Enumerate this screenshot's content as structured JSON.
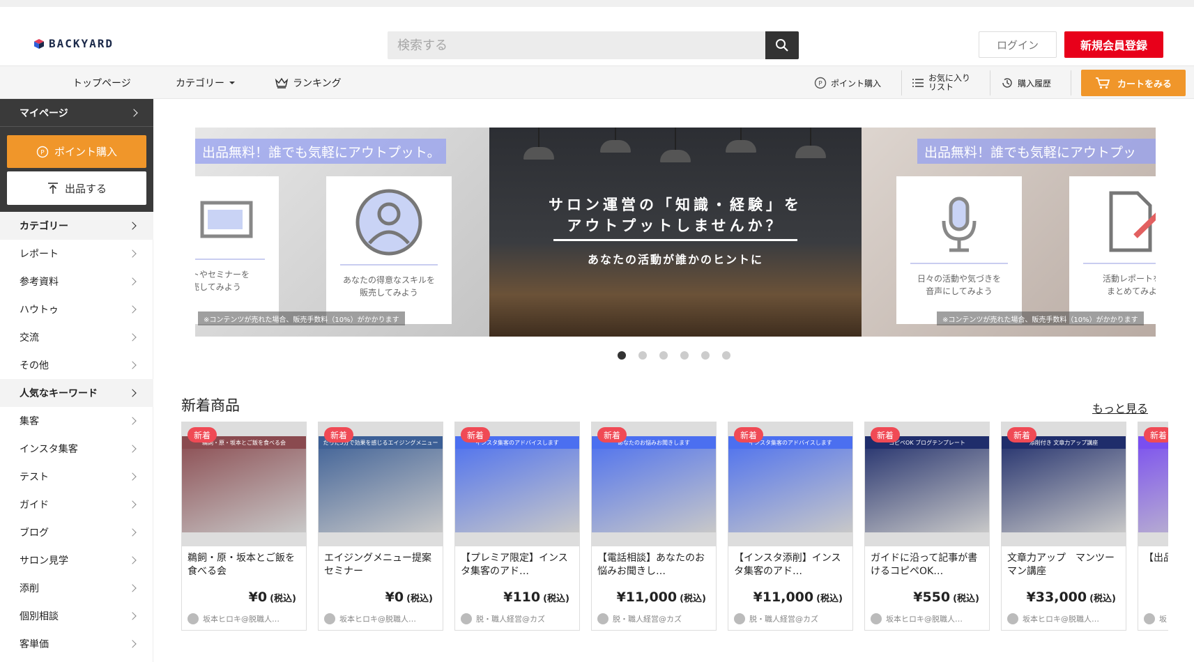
{
  "header": {
    "logo_text": "BACKYARD",
    "search_placeholder": "検索する",
    "login_label": "ログイン",
    "register_label": "新規会員登録"
  },
  "nav": {
    "top": "トップページ",
    "category": "カテゴリー",
    "ranking": "ランキング",
    "point_purchase": "ポイント購入",
    "favorites_line1": "お気に入り",
    "favorites_line2": "リスト",
    "history": "購入履歴",
    "cart": "カートをみる"
  },
  "sidebar": {
    "mypage": "マイページ",
    "point_button": "ポイント購入",
    "sell_button": "出品する",
    "category_head": "カテゴリー",
    "categories": [
      "レポート",
      "参考資料",
      "ハウトゥ",
      "交流",
      "その他"
    ],
    "keyword_head": "人気なキーワード",
    "keywords": [
      "集客",
      "インスタ集客",
      "テスト",
      "ガイド",
      "ブログ",
      "サロン見学",
      "添削",
      "個別相談",
      "客単価"
    ]
  },
  "banner": {
    "ribbon_left": "出品無料！誰でも気軽にアウトプット。",
    "ribbon_right": "出品無料！誰でも気軽にアウトプッ",
    "card_left1": "ントやセミナーを\n売してみよう",
    "card_left2": "あなたの得意なスキルを\n販売してみよう",
    "card_right1": "日々の活動や気づきを\n音声にしてみよう",
    "card_right2": "活動レポートを\nまとめてみよ",
    "note": "※コンテンツが売れた場合、販売手数料（10%）がかかります",
    "title": "サロン運営の「知識・経験」を\nアウトプットしませんか？",
    "subtitle": "あなたの活動が誰かのヒントに",
    "dots_total": 6,
    "active_dot": 0
  },
  "section": {
    "title": "新着商品",
    "more": "もっと見る"
  },
  "products": [
    {
      "badge": "新着",
      "title": "鵜飼・原・坂本とご飯を食べる会",
      "price": "¥0",
      "tax": "(税込)",
      "seller": "坂本ヒロキ@脱職人…",
      "thumb_text": "鵜飼・原・坂本とご飯を食べる会",
      "thumb_color": "#8a4a4f"
    },
    {
      "badge": "新着",
      "title": "エイジングメニュー提案セミナー",
      "price": "¥0",
      "tax": "(税込)",
      "seller": "坂本ヒロキ@脱職人…",
      "thumb_text": "たった5分で効果を感じるエイジングメニュー",
      "thumb_color": "#3c5f96"
    },
    {
      "badge": "新着",
      "title": "【プレミア限定】インスタ集客のアド…",
      "price": "¥110",
      "tax": "(税込)",
      "seller": "脱・職人経営@カズ",
      "thumb_text": "インスタ集客のアドバイスします",
      "thumb_color": "#4b6ff0"
    },
    {
      "badge": "新着",
      "title": "【電話相談】あなたのお悩みお聞きし…",
      "price": "¥11,000",
      "tax": "(税込)",
      "seller": "脱・職人経営@カズ",
      "thumb_text": "あなたのお悩みお聞きします",
      "thumb_color": "#4b6ff0"
    },
    {
      "badge": "新着",
      "title": "【インスタ添削】インスタ集客のアド…",
      "price": "¥11,000",
      "tax": "(税込)",
      "seller": "脱・職人経営@カズ",
      "thumb_text": "インスタ集客のアドバイスします",
      "thumb_color": "#4b6ff0"
    },
    {
      "badge": "新着",
      "title": "ガイドに沿って記事が書けるコピペOK…",
      "price": "¥550",
      "tax": "(税込)",
      "seller": "坂本ヒロキ@脱職人…",
      "thumb_text": "コピペOK ブログテンプレート",
      "thumb_color": "#1f2d6b"
    },
    {
      "badge": "新着",
      "title": "文章力アップ　マンツーマン講座",
      "price": "¥33,000",
      "tax": "(税込)",
      "seller": "坂本ヒロキ@脱職人…",
      "thumb_text": "添削付き 文章力アップ講座",
      "thumb_color": "#1f2d6b"
    },
    {
      "badge": "新着",
      "title": "【出品ンツの",
      "price": "",
      "tax": "",
      "seller": "坂",
      "thumb_text": "",
      "thumb_color": "#7a4ef0"
    }
  ],
  "colors": {
    "accent_orange": "#f0962a",
    "register_red": "#e8001a",
    "badge_red": "#f04a55"
  }
}
